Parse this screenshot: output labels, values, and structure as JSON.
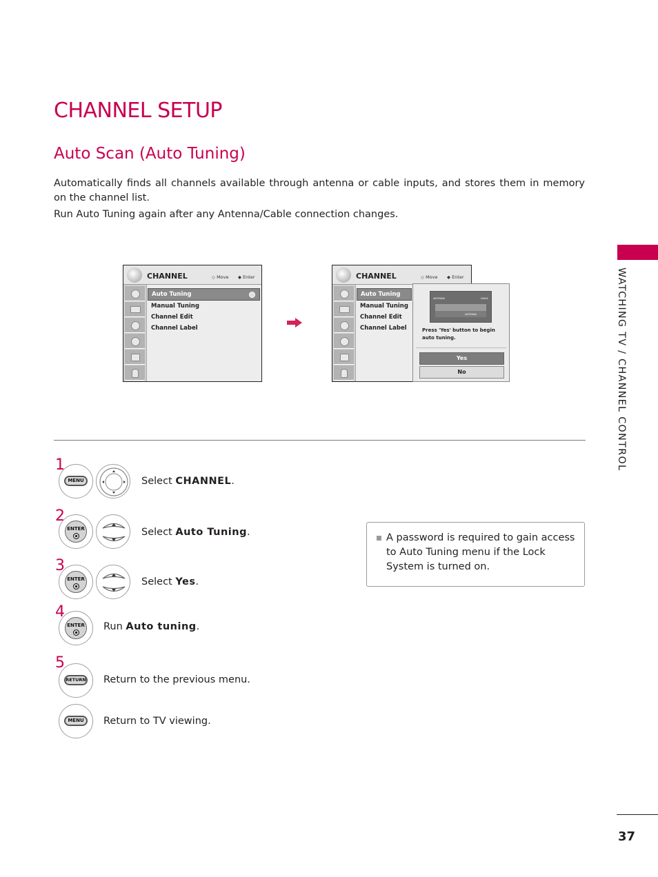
{
  "page": {
    "title": "CHANNEL SETUP",
    "section_title": "Auto Scan (Auto Tuning)",
    "intro": [
      "Automatically finds all channels available through antenna or cable inputs, and stores them in memory on the channel list.",
      "Run Auto Tuning again after any Antenna/Cable connection changes."
    ],
    "side_tab_label": "WATCHING TV / CHANNEL CONTROL",
    "page_number": "37",
    "accent_color": "#c8004f"
  },
  "tv_menu": {
    "title": "CHANNEL",
    "hint_move": "Move",
    "hint_enter": "Enter",
    "items": [
      "Auto Tuning",
      "Manual Tuning",
      "Channel Edit",
      "Channel Label"
    ],
    "selected_index": 0,
    "side_icons": [
      "channel-icon",
      "picture-icon",
      "audio-icon",
      "time-icon",
      "option-icon",
      "lock-icon"
    ]
  },
  "popup": {
    "diagram_labels": {
      "antenna": "ANTENNA",
      "cable": "CABLE",
      "input": "ANTENNA"
    },
    "message": "Press 'Yes' button to begin auto tuning.",
    "yes_label": "Yes",
    "no_label": "No"
  },
  "steps": [
    {
      "number": "1",
      "buttons": [
        "MENU",
        "nav-4way"
      ],
      "prefix": "Select ",
      "bold": "CHANNEL",
      "suffix": "."
    },
    {
      "number": "2",
      "buttons": [
        "ENTER",
        "nav-updown"
      ],
      "prefix": "Select ",
      "bold": "Auto Tuning",
      "suffix": "."
    },
    {
      "number": "3",
      "buttons": [
        "ENTER",
        "nav-updown"
      ],
      "prefix": "Select ",
      "bold": "Yes",
      "suffix": "."
    },
    {
      "number": "4",
      "buttons": [
        "ENTER"
      ],
      "prefix": "Run ",
      "bold": "Auto tuning",
      "suffix": "."
    },
    {
      "number": "5",
      "buttons": [
        "RETURN"
      ],
      "prefix": "Return to the previous menu.",
      "bold": "",
      "suffix": ""
    },
    {
      "number": "",
      "buttons": [
        "MENU"
      ],
      "prefix": "Return to TV viewing.",
      "bold": "",
      "suffix": ""
    }
  ],
  "remote_labels": {
    "menu": "MENU",
    "enter": "ENTER",
    "return": "RETURN"
  },
  "note": {
    "text": "A password is required to gain access to Auto Tuning menu if the Lock System is turned on."
  }
}
